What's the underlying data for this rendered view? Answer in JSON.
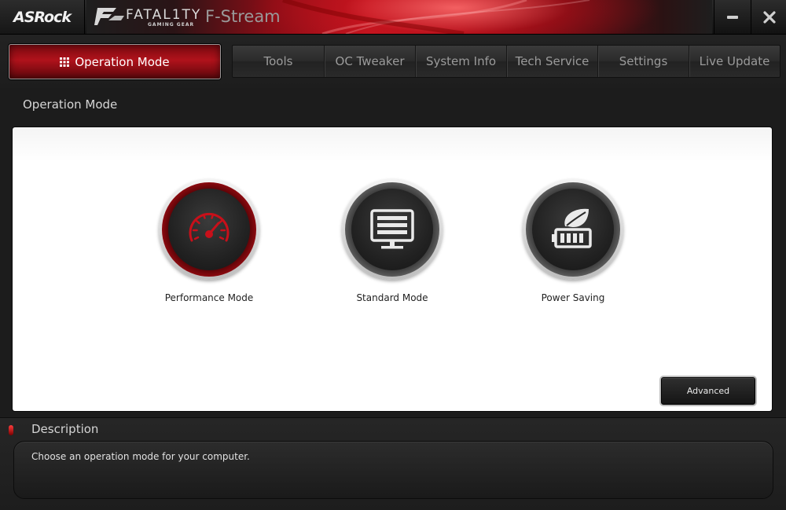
{
  "titlebar": {
    "brand": "ASRock",
    "logo_word": "FATAL1TY",
    "logo_sub": "GAMING GEAR",
    "app_title": "F-Stream",
    "minimize_icon": "minimize-icon",
    "close_icon": "close-icon"
  },
  "nav": {
    "active_tab": "Operation Mode",
    "tabs": [
      "Tools",
      "OC Tweaker",
      "System Info",
      "Tech Service",
      "Settings",
      "Live Update"
    ]
  },
  "main": {
    "section_title": "Operation Mode",
    "modes": [
      {
        "label": "Performance Mode",
        "icon": "speedometer-icon",
        "selected": true
      },
      {
        "label": "Standard Mode",
        "icon": "monitor-icon",
        "selected": false
      },
      {
        "label": "Power Saving",
        "icon": "leaf-battery-icon",
        "selected": false
      }
    ],
    "advanced_label": "Advanced"
  },
  "description": {
    "title": "Description",
    "text": "Choose an operation mode for your computer."
  },
  "colors": {
    "accent_red": "#c3141f",
    "panel_bg": "#ffffff",
    "chrome_dark": "#1c1c1c"
  }
}
